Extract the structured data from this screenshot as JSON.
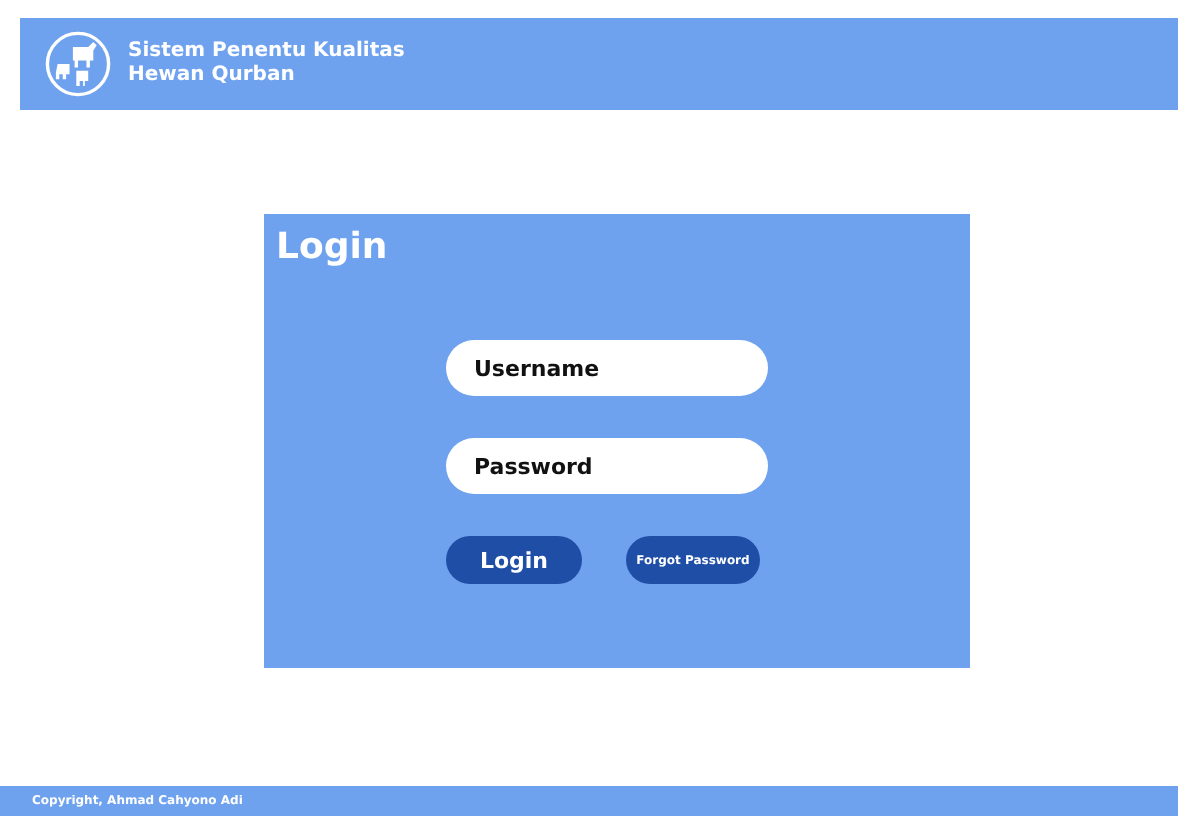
{
  "header": {
    "title_line_1": "Sistem Penentu Kualitas",
    "title_line_2": "Hewan Qurban"
  },
  "login_card": {
    "title": "Login",
    "username": {
      "placeholder": "Username"
    },
    "password": {
      "placeholder": "Password"
    },
    "buttons": [
      "Login",
      "Forgot Password"
    ]
  },
  "footer": {
    "text": "Copyright, Ahmad Cahyono Adi"
  }
}
